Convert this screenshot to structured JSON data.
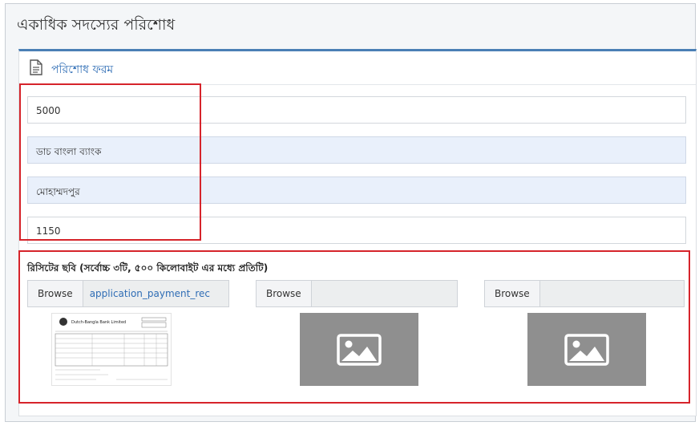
{
  "page": {
    "title": "একাধিক সদস্যের পরিশোধ"
  },
  "form": {
    "title": "পরিশোধ ফরম",
    "icon": "document-icon",
    "amount": "5000",
    "bank": "ডাচ বাংলা ব্যাংক",
    "branch": "মোহাম্মদপুর",
    "code": "1150"
  },
  "upload": {
    "label": "রিসিটের ছবি (সর্বোচ্চ ৩টি, ৫০০ কিলোবাইট এর মধ্যে প্রতিটি)",
    "slots": [
      {
        "button": "Browse",
        "file": "application_payment_rec",
        "preview": "receipt-image"
      },
      {
        "button": "Browse",
        "file": "",
        "preview": "image-placeholder-icon"
      },
      {
        "button": "Browse",
        "file": "",
        "preview": "image-placeholder-icon"
      }
    ]
  },
  "receipt": {
    "bank_name": "Dutch-Bangla Bank Limited"
  },
  "colors": {
    "accent": "#4a7fb5",
    "link": "#2f6db5",
    "highlight": "#d6242b",
    "readonly_bg": "#e9f0fb"
  }
}
